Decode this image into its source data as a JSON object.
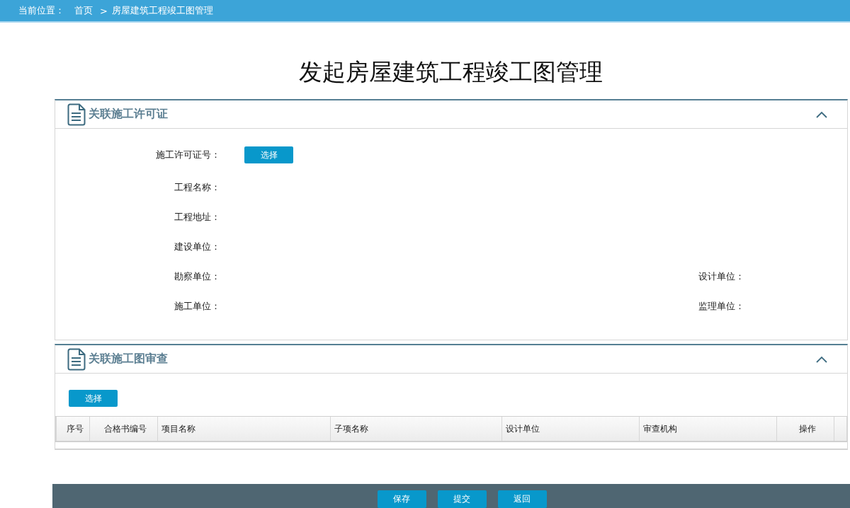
{
  "breadcrumb": {
    "label": "当前位置：",
    "home": "首页",
    "separator": ">",
    "current": "房屋建筑工程竣工图管理"
  },
  "page_title": "发起房屋建筑工程竣工图管理",
  "permit_section": {
    "title": "关联施工许可证",
    "expanded": true,
    "permit_label": "施工许可证号：",
    "select_button": "选择",
    "rows": [
      {
        "left": "工程名称："
      },
      {
        "left": "工程地址："
      },
      {
        "left": "建设单位："
      },
      {
        "left": "勘察单位：",
        "right": "设计单位："
      },
      {
        "left": "施工单位：",
        "right": "监理单位："
      }
    ]
  },
  "review_section": {
    "title": "关联施工图审查",
    "expanded": true,
    "select_button": "选择",
    "table": {
      "columns": [
        "序号",
        "合格书编号",
        "项目名称",
        "子项名称",
        "设计单位",
        "审查机构",
        "操作"
      ]
    }
  },
  "footer_buttons": [
    "保存",
    "提交",
    "返回"
  ]
}
